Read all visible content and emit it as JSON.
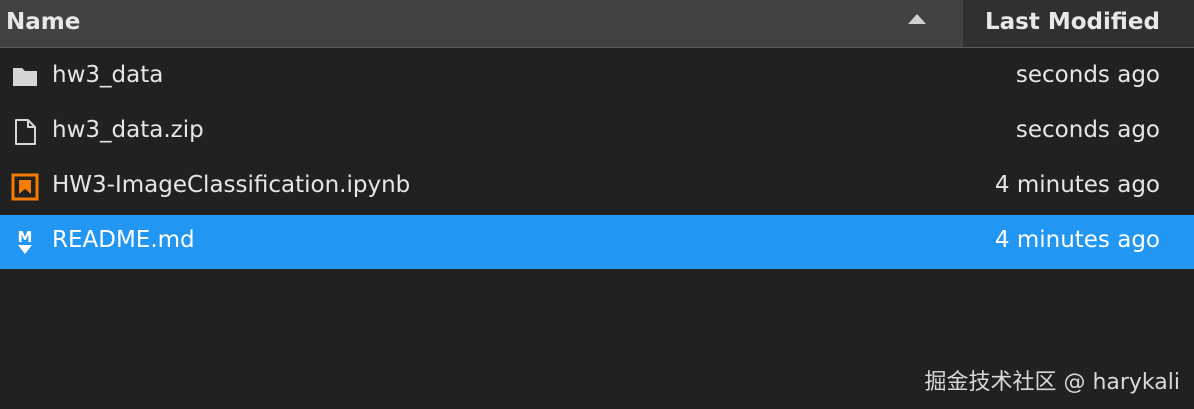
{
  "header": {
    "name_label": "Name",
    "modified_label": "Last Modified",
    "sort": "ascending"
  },
  "files": [
    {
      "name": "hw3_data",
      "modified": "seconds ago",
      "icon": "folder-icon",
      "selected": false
    },
    {
      "name": "hw3_data.zip",
      "modified": "seconds ago",
      "icon": "file-icon",
      "selected": false
    },
    {
      "name": "HW3-ImageClassification.ipynb",
      "modified": "4 minutes ago",
      "icon": "notebook-icon",
      "selected": false
    },
    {
      "name": "README.md",
      "modified": "4 minutes ago",
      "icon": "markdown-icon",
      "selected": true
    }
  ],
  "watermark": "掘金技术社区 @ harykali",
  "colors": {
    "background": "#212121",
    "header": "#424242",
    "header_active": "#303030",
    "selected_row": "#2196f3",
    "notebook_icon": "#f57c00"
  }
}
